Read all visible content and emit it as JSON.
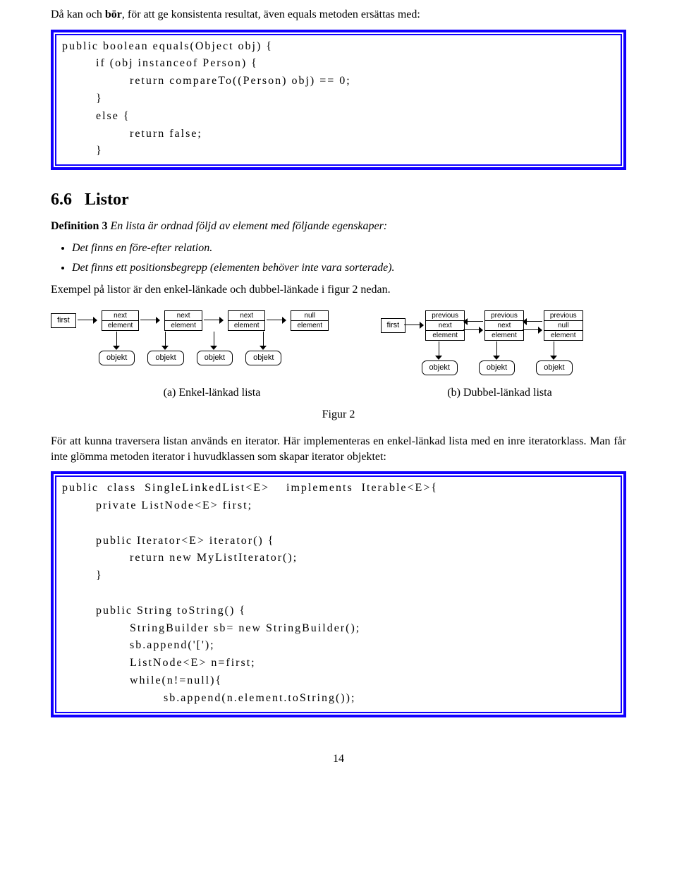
{
  "intro": {
    "sentence_prefix": "Då kan och ",
    "sentence_bold": "bör",
    "sentence_suffix": ", för att ge konsistenta resultat, även equals metoden ersättas med:"
  },
  "code1": "public boolean equals(Object obj) {\n        if (obj instanceof Person) {\n                return compareTo((Person) obj) == 0;\n        }\n        else {\n                return false;\n        }",
  "section": {
    "number": "6.6",
    "title": "Listor"
  },
  "definition": {
    "label": "Definition 3",
    "text": "En lista är ordnad följd av element med följande egenskaper:"
  },
  "bullets": [
    "Det finns en före-efter relation.",
    "Det finns ett positionsbegrepp (elementen behöver inte vara sorterade)."
  ],
  "after_bullets": "Exempel på listor är den enkel-länkade och dubbel-länkade i figur 2 nedan.",
  "fig": {
    "first": "first",
    "node_next": "next",
    "node_null": "null",
    "node_prev": "previous",
    "node_elem": "element",
    "objekt": "objekt",
    "cap_a": "(a) Enkel-länkad lista",
    "cap_b": "(b) Dubbel-länkad lista",
    "caption": "Figur 2"
  },
  "para2": "För att kunna traversera listan används en iterator. Här implementeras en enkel-länkad lista med en inre iteratorklass. Man får inte glömma metoden iterator i huvudklassen som skapar iterator objektet:",
  "code2": "public  class  SingleLinkedList<E>    implements  Iterable<E>{\n        private ListNode<E> first;\n\n        public Iterator<E> iterator() {\n                return new MyListIterator();\n        }\n\n        public String toString() {\n                StringBuilder sb= new StringBuilder();\n                sb.append('[');\n                ListNode<E> n=first;\n                while(n!=null){\n                        sb.append(n.element.toString());",
  "pagenum": "14"
}
